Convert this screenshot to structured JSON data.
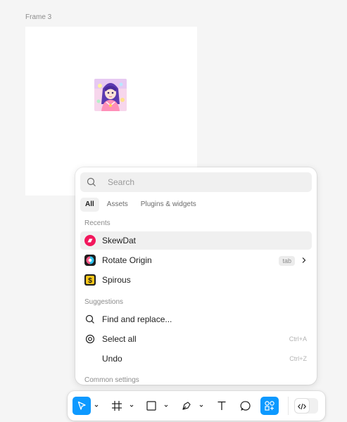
{
  "canvas": {
    "frame_label": "Frame 3"
  },
  "search": {
    "placeholder": "Search",
    "value": ""
  },
  "tabs": [
    {
      "label": "All",
      "active": true
    },
    {
      "label": "Assets",
      "active": false
    },
    {
      "label": "Plugins & widgets",
      "active": false
    }
  ],
  "sections": {
    "recents_title": "Recents",
    "suggestions_title": "Suggestions",
    "common_settings_title": "Common settings"
  },
  "recents": [
    {
      "label": "SkewDat",
      "icon": "skewdat-plugin-icon",
      "selected": true
    },
    {
      "label": "Rotate Origin",
      "icon": "rotate-origin-plugin-icon",
      "badge": "tab",
      "chevron": true
    },
    {
      "label": "Spirous",
      "icon": "spirous-plugin-icon"
    }
  ],
  "suggestions": [
    {
      "label": "Find and replace...",
      "icon": "search-icon",
      "shortcut": ""
    },
    {
      "label": "Select all",
      "icon": "target-icon",
      "shortcut": "Ctrl+A"
    },
    {
      "label": "Undo",
      "icon": "",
      "shortcut": "Ctrl+Z"
    }
  ],
  "toolbar": {
    "tools": [
      "move-tool",
      "frame-tool",
      "shape-tool",
      "pen-tool",
      "text-tool",
      "comment-tool",
      "actions-tool"
    ],
    "active_tool": "actions-tool",
    "dev_mode_toggle": "code-icon"
  },
  "colors": {
    "accent": "#0d99ff",
    "skewdat": "#f2175c",
    "spirous_bg": "#1e1e1e",
    "spirous_fg": "#f5c518"
  }
}
